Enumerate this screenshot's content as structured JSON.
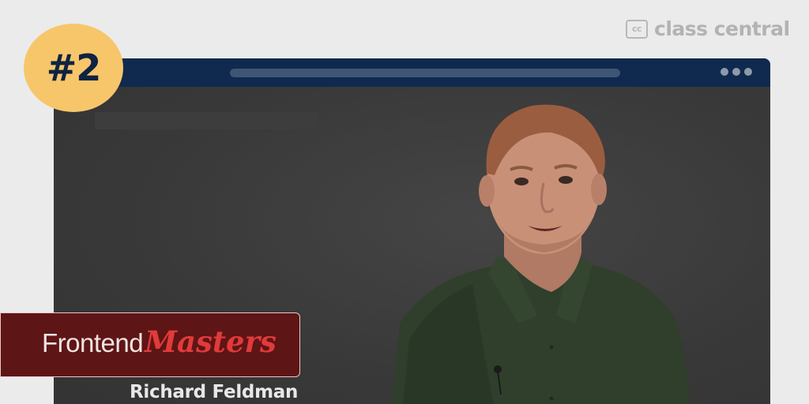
{
  "brand": {
    "icon": "class-central-logo-icon",
    "icon_text": "cc",
    "name": "class central",
    "color": "#b3b3b3"
  },
  "badge": {
    "rank": "#2",
    "color": "#f7c66b",
    "text_color": "#0f2342"
  },
  "browser": {
    "bar_color": "#0f2a4e",
    "menu_icon": "more-dots-icon"
  },
  "provider": {
    "name_part_1": "Frontend",
    "name_part_2": "Masters",
    "background": "#5e1516",
    "accent": "#e23a3a"
  },
  "instructor": {
    "name": "Richard Feldman"
  }
}
